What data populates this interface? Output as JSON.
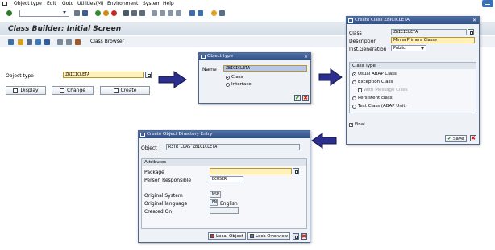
{
  "menu": {
    "items": [
      "Object type",
      "Edit",
      "Goto",
      "Utilities(M)",
      "Environment",
      "System",
      "Help"
    ]
  },
  "title": "Class Builder: Initial Screen",
  "app_toolbar": {
    "class_browser_label": "Class Browser"
  },
  "main": {
    "object_type_label": "Object type",
    "object_type_value": "ZBICICLETA",
    "display_label": "Display",
    "change_label": "Change",
    "create_label": "Create"
  },
  "object_type_dialog": {
    "title": "Object type",
    "name_label": "Name",
    "name_value": "ZBICICLETA",
    "radio_class": "Class",
    "radio_interface": "Interface",
    "radio_class_selected": true
  },
  "create_class_dialog": {
    "title": "Create Class ZBICICLETA",
    "class_label": "Class",
    "class_value": "ZBICICLETA",
    "description_label": "Description",
    "description_value": "Minha Primera Classe",
    "instgen_label": "Inst.Generation",
    "instgen_value": "Public",
    "class_type_group": "Class Type",
    "class_types": [
      "Usual ABAP Class",
      "Exception Class",
      "Persistent class",
      "Test Class (ABAP Unit)"
    ],
    "with_message_class": "With Message Class",
    "final_label": "Final",
    "save_label": "Save"
  },
  "object_directory_dialog": {
    "title": "Create Object Directory Entry",
    "object_label": "Object",
    "object_value": "R3TR CLAS ZBICICLETA",
    "attributes_group": "Attributes",
    "package_label": "Package",
    "package_value": "",
    "person_label": "Person Responsible",
    "person_value": "BCUSER",
    "orig_system_label": "Original System",
    "orig_system_value": "NSP",
    "orig_lang_label": "Original language",
    "orig_lang_code": "EN",
    "orig_lang_name": "English",
    "created_on_label": "Created On",
    "created_on_value": "",
    "local_object_label": "Local Object",
    "lock_overview_label": "Lock Overview"
  },
  "colors": {
    "dialog_header": "#2f4f86",
    "arrow_blue": "#2b2e8c",
    "required_field": "#fff1b8"
  }
}
